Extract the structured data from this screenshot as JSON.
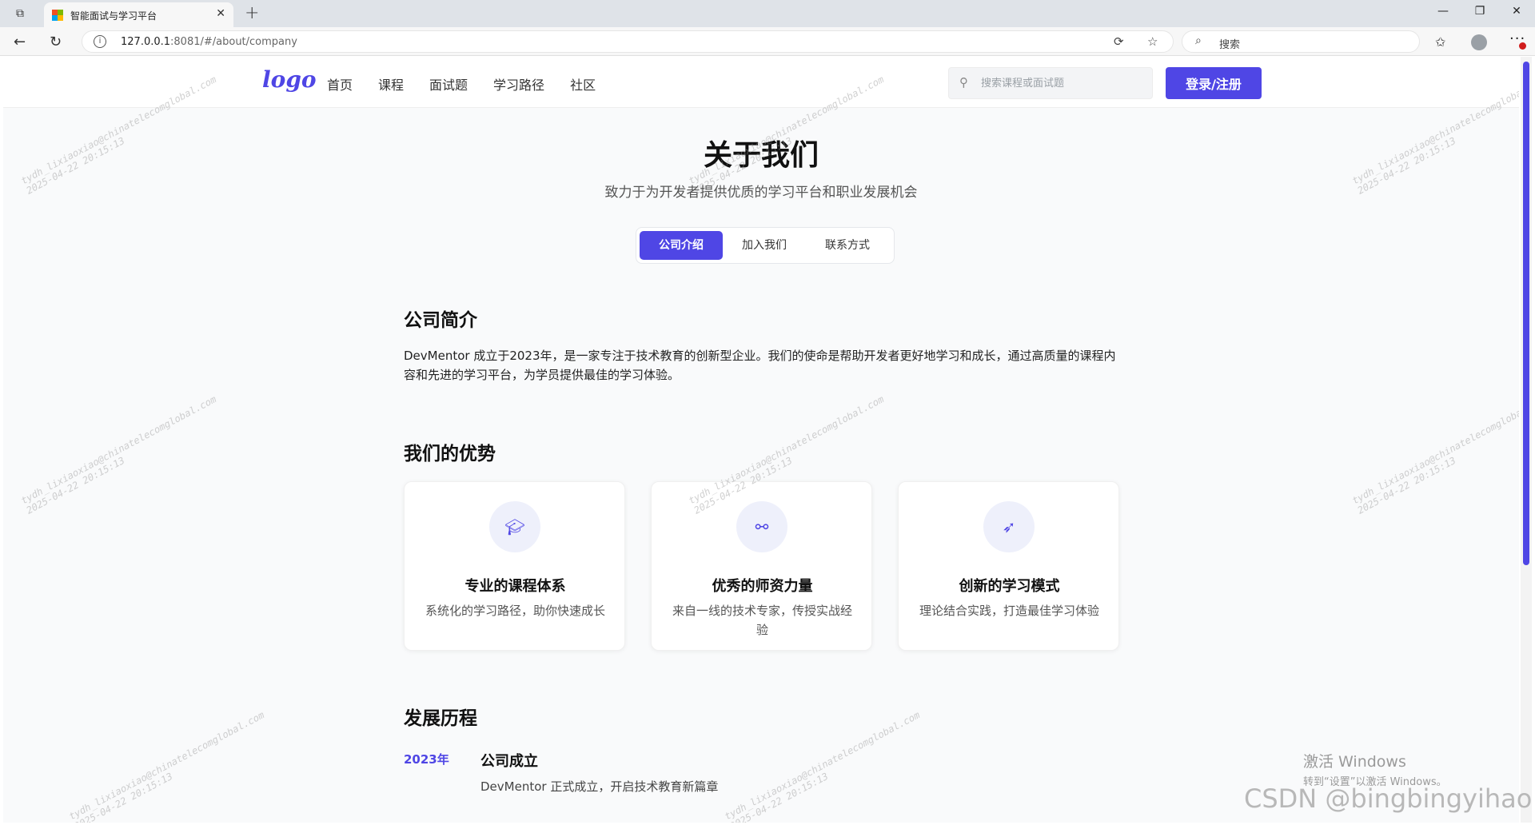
{
  "browser": {
    "tab_title": "智能面试与学习平台",
    "url_host": "127.0.0.1",
    "url_rest": ":8081/#/about/company",
    "search_placeholder": "搜索"
  },
  "site": {
    "logo": "logo",
    "nav": [
      "首页",
      "课程",
      "面试题",
      "学习路径",
      "社区"
    ],
    "search_placeholder": "搜索课程或面试题",
    "login_label": "登录/注册"
  },
  "page": {
    "title": "关于我们",
    "subtitle": "致力于为开发者提供优质的学习平台和职业发展机会",
    "tabs": [
      "公司介绍",
      "加入我们",
      "联系方式"
    ],
    "active_tab": "公司介绍",
    "intro_heading": "公司简介",
    "intro_text": "DevMentor 成立于2023年，是一家专注于技术教育的创新型企业。我们的使命是帮助开发者更好地学习和成长，通过高质量的课程内容和先进的学习平台，为学员提供最佳的学习体验。",
    "advantages_heading": "我们的优势",
    "advantages": [
      {
        "icon": "graduation-cap-icon",
        "title": "专业的课程体系",
        "desc": "系统化的学习路径，助你快速成长"
      },
      {
        "icon": "handshake-icon",
        "title": "优秀的师资力量",
        "desc": "来自一线的技术专家，传授实战经验"
      },
      {
        "icon": "rocket-icon",
        "title": "创新的学习模式",
        "desc": "理论结合实践，打造最佳学习体验"
      }
    ],
    "history_heading": "发展历程",
    "history": [
      {
        "year": "2023年",
        "title": "公司成立",
        "desc": "DevMentor 正式成立，开启技术教育新篇章"
      }
    ]
  },
  "overlay": {
    "activate_title": "激活 Windows",
    "activate_sub": "转到“设置”以激活 Windows。",
    "csdn": "CSDN @bingbingyihao",
    "watermark_line1": "tydh_lixiaoxiao@chinatelecomglobal.com",
    "watermark_line2": "2025-04-22 20:15:13"
  },
  "colors": {
    "accent": "#4f46e5",
    "page_bg": "#f9fafb"
  }
}
